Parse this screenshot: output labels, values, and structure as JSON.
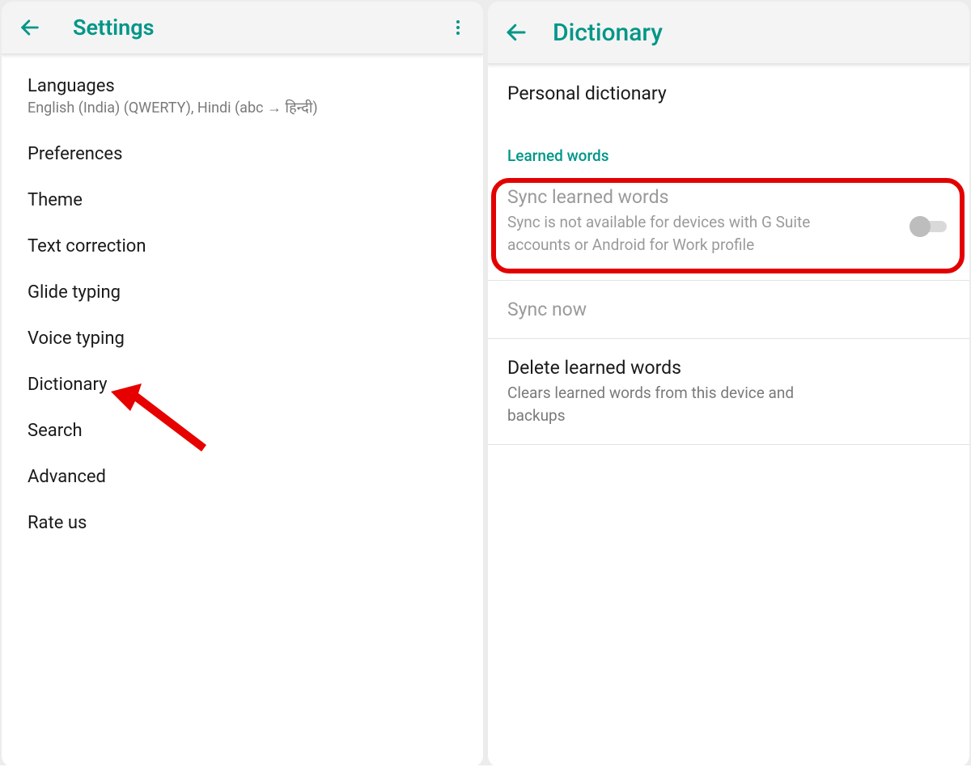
{
  "left": {
    "title": "Settings",
    "items": [
      {
        "title": "Languages",
        "sub": "English (India) (QWERTY), Hindi (abc → हिन्दी)"
      },
      {
        "title": "Preferences"
      },
      {
        "title": "Theme"
      },
      {
        "title": "Text correction"
      },
      {
        "title": "Glide typing"
      },
      {
        "title": "Voice typing"
      },
      {
        "title": "Dictionary"
      },
      {
        "title": "Search"
      },
      {
        "title": "Advanced"
      },
      {
        "title": "Rate us"
      }
    ]
  },
  "right": {
    "title": "Dictionary",
    "personal": {
      "title": "Personal dictionary"
    },
    "section_header": "Learned words",
    "sync": {
      "title": "Sync learned words",
      "sub": "Sync is not available for devices with G Suite accounts or Android for Work profile"
    },
    "sync_now": {
      "title": "Sync now"
    },
    "delete": {
      "title": "Delete learned words",
      "sub": "Clears learned words from this device and backups"
    }
  }
}
